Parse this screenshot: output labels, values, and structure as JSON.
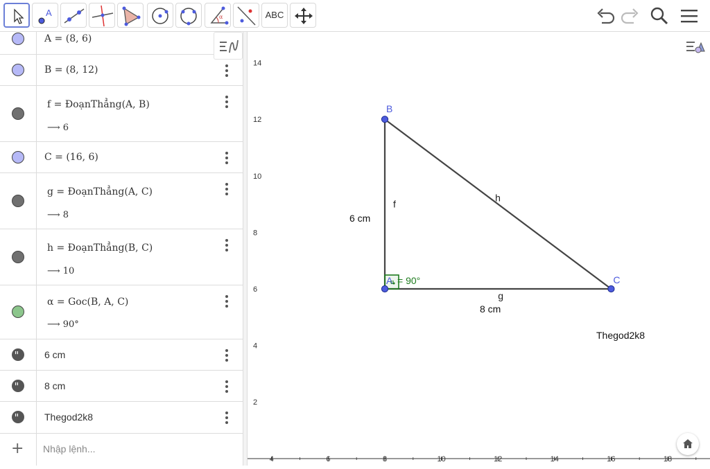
{
  "toolbar": {
    "tools": [
      "move",
      "point",
      "line",
      "perpendicular-line",
      "polygon",
      "circle-center",
      "circle-three-points",
      "angle",
      "reflect",
      "text",
      "move-graphics-view"
    ],
    "text_tool_label": "ABC"
  },
  "algebra": {
    "rows": [
      {
        "def": "A = (8, 6)",
        "color": "#b6b9f7"
      },
      {
        "def": "B = (8, 12)",
        "color": "#b6b9f7"
      },
      {
        "def": "f = ĐoạnThẳng(A, B)",
        "out": "⟶ 6",
        "color": "#707070"
      },
      {
        "def": "C = (16, 6)",
        "color": "#b6b9f7"
      },
      {
        "def": "g = ĐoạnThẳng(A, C)",
        "out": "⟶ 8",
        "color": "#707070"
      },
      {
        "def": "h = ĐoạnThẳng(B, C)",
        "out": "⟶ 10",
        "color": "#707070"
      },
      {
        "def": "α = Goc(B, A, C)",
        "out": "⟶ 90°",
        "color": "#8cc68c"
      },
      {
        "def": "6 cm"
      },
      {
        "def": "8 cm"
      },
      {
        "def": "Thegod2k8"
      }
    ],
    "input_placeholder": "Nhập lệnh..."
  },
  "graphics": {
    "x_ticks": [
      "4",
      "6",
      "8",
      "10",
      "12",
      "14",
      "16",
      "18"
    ],
    "y_ticks": [
      "2",
      "4",
      "6",
      "8",
      "10",
      "12",
      "14"
    ],
    "points": [
      {
        "name": "A",
        "x": 8,
        "y": 6
      },
      {
        "name": "B",
        "x": 8,
        "y": 12
      },
      {
        "name": "C",
        "x": 16,
        "y": 6
      }
    ],
    "segment_labels": {
      "f": "f",
      "g": "g",
      "h": "h"
    },
    "angle_label": "α = 90°",
    "angle_symbol": "α",
    "angle_text": "= 90°",
    "texts": {
      "six_cm": "6 cm",
      "eight_cm": "8 cm",
      "author": "Thegod2k8"
    },
    "colors": {
      "point": "#4d5bdd",
      "segment": "#444444",
      "angle": "#1e7b1e",
      "label_point": "#4d5bdd"
    }
  }
}
